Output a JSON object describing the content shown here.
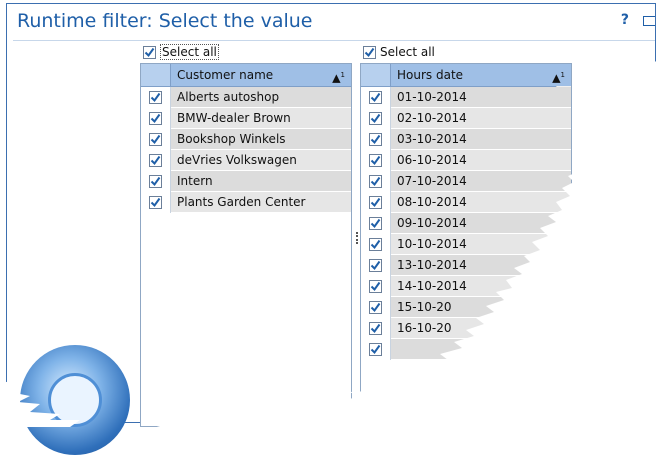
{
  "dialog": {
    "title": "Runtime filter: Select the value",
    "help_label": "?"
  },
  "left_panel": {
    "select_all_label": "Select all",
    "select_all_checked": true,
    "column_header": "Customer name",
    "sort_label": "^",
    "sort_index": "1",
    "rows": [
      {
        "label": "Alberts autoshop",
        "checked": true
      },
      {
        "label": "BMW-dealer Brown",
        "checked": true
      },
      {
        "label": "Bookshop Winkels",
        "checked": true
      },
      {
        "label": "deVries Volkswagen",
        "checked": true
      },
      {
        "label": "Intern",
        "checked": true
      },
      {
        "label": "Plants Garden Center",
        "checked": true
      }
    ]
  },
  "right_panel": {
    "select_all_label": "Select all",
    "select_all_checked": true,
    "column_header": "Hours date",
    "sort_label": "^",
    "sort_index": "1",
    "rows": [
      {
        "label": "01-10-2014",
        "checked": true
      },
      {
        "label": "02-10-2014",
        "checked": true
      },
      {
        "label": "03-10-2014",
        "checked": true
      },
      {
        "label": "06-10-2014",
        "checked": true
      },
      {
        "label": "07-10-2014",
        "checked": true
      },
      {
        "label": "08-10-2014",
        "checked": true
      },
      {
        "label": "09-10-2014",
        "checked": true
      },
      {
        "label": "10-10-2014",
        "checked": true
      },
      {
        "label": "13-10-2014",
        "checked": true
      },
      {
        "label": "14-10-2014",
        "checked": true
      },
      {
        "label": "15-10-20",
        "checked": true
      },
      {
        "label": "16-10-20",
        "checked": true
      },
      {
        "label": "",
        "checked": true
      }
    ]
  },
  "colors": {
    "title": "#1f5fa8",
    "header": "#9fbfe6",
    "check": "#1f5fa8"
  }
}
